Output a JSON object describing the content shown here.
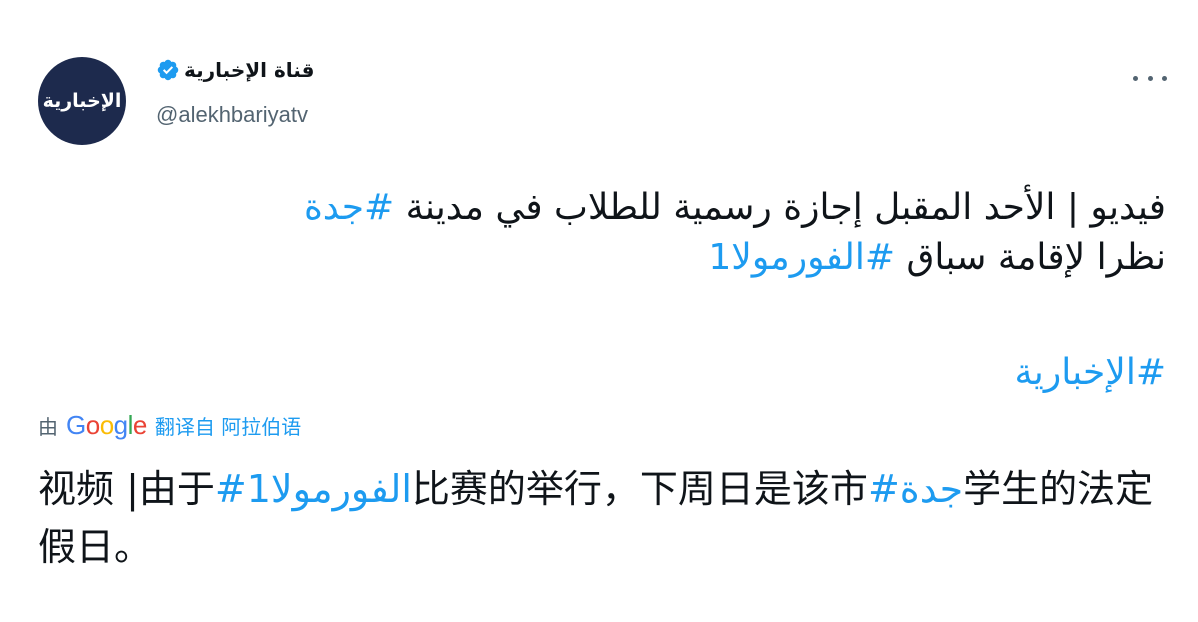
{
  "account": {
    "avatar_text": "الإخبارية",
    "display_name": "قناة الإخبارية",
    "handle": "@alekhbariyatv",
    "verified_icon": "verified-badge-icon"
  },
  "menu": {
    "icon": "more-icon"
  },
  "tweet": {
    "line1_text": "فيديو | الأحد المقبل إجازة رسمية للطلاب في مدينة ",
    "line1_hashtag": "#جدة",
    "line2_text": "نظرا لإقامة سباق ",
    "line2_hashtag": "#الفورمولا1",
    "hashtag_line": "#الإخبارية"
  },
  "translation": {
    "by_label": "由",
    "google_letters": [
      "G",
      "o",
      "o",
      "g",
      "l",
      "e"
    ],
    "link_label": "翻译自 阿拉伯语",
    "part1": "视频 |由于",
    "hashtag1": "#الفورمولا1",
    "part2": "比赛的举行，下周日是该市",
    "hashtag2": "#جدة",
    "part3": "学生的法定假日。"
  },
  "colors": {
    "link": "#1d9bf0",
    "text": "#0f1419",
    "secondary": "#536471",
    "avatar_bg": "#1d2a4d"
  }
}
